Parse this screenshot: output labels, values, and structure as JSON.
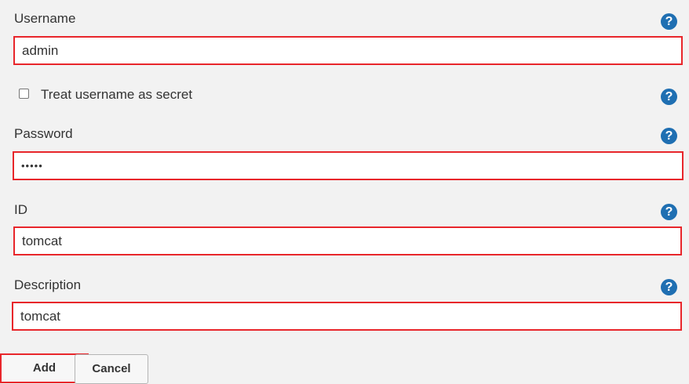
{
  "form": {
    "username": {
      "label": "Username",
      "value": "admin",
      "help_icon": "question-circle-icon"
    },
    "treat_username_secret": {
      "label": "Treat username as secret",
      "checked": false,
      "help_icon": "question-circle-icon"
    },
    "password": {
      "label": "Password",
      "masked_value": "•••••",
      "help_icon": "question-circle-icon"
    },
    "id": {
      "label": "ID",
      "value": "tomcat",
      "help_icon": "question-circle-icon"
    },
    "description": {
      "label": "Description",
      "value": "tomcat",
      "help_icon": "question-circle-icon"
    },
    "help_glyph": "?"
  },
  "actions": {
    "add_label": "Add",
    "cancel_label": "Cancel"
  },
  "colors": {
    "background": "#f2f2f2",
    "highlight_border": "#e8262b",
    "help_icon_bg": "#1f6fb2",
    "text": "#333333"
  }
}
